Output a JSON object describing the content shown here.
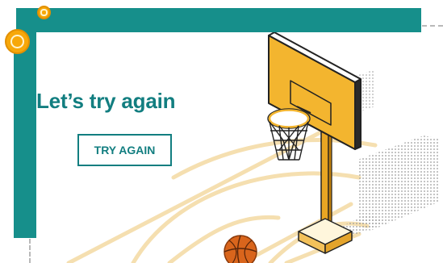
{
  "message": {
    "title": "Let’s try again"
  },
  "actions": {
    "try_again_label": "TRY AGAIN"
  },
  "icons": {
    "coin_small": "coin-icon",
    "coin_large": "coin-icon",
    "hoop": "basketball-hoop-icon",
    "ball": "basketball-icon"
  },
  "colors": {
    "accent": "#127e80",
    "frame": "#168f8b",
    "backboard": "#f3b52f",
    "court_lines": "#f5dfb0",
    "coin": "#f7a80a",
    "ball": "#d9651c"
  }
}
